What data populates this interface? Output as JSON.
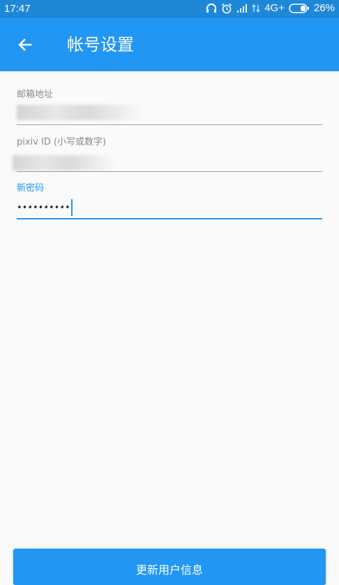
{
  "status_bar": {
    "time": "17:47",
    "network": "4G+",
    "battery": "26%",
    "icons": [
      "headphone-icon",
      "alarm-icon",
      "signal-icon",
      "data-signal-icon",
      "battery-icon"
    ]
  },
  "app_bar": {
    "back_icon": "arrow-left-icon",
    "title": "帐号设置",
    "background": "#2196f3"
  },
  "form": {
    "email": {
      "label": "邮箱地址"
    },
    "pixiv_id": {
      "label": "pixiv ID (小写或数字)"
    },
    "new_password": {
      "label": "新密码",
      "value": "••••••••••"
    }
  },
  "submit": {
    "label": "更新用户信息"
  },
  "colors": {
    "accent": "#2196f3",
    "status_bar": "#1e88d8"
  }
}
